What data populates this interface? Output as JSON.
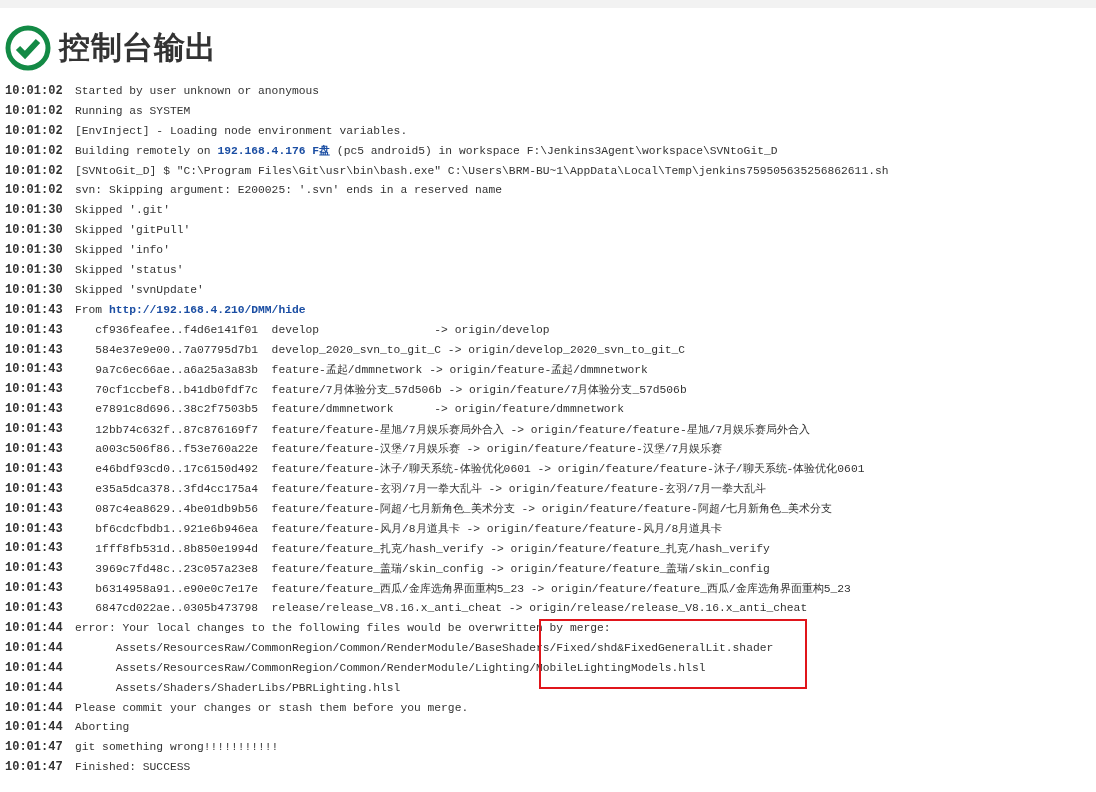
{
  "title": "控制台输出",
  "log": [
    {
      "time": "10:01:02",
      "segments": [
        {
          "kind": "plain",
          "text": "Started by user unknown or anonymous"
        }
      ]
    },
    {
      "time": "10:01:02",
      "segments": [
        {
          "kind": "plain",
          "text": "Running as SYSTEM"
        }
      ]
    },
    {
      "time": "10:01:02",
      "segments": [
        {
          "kind": "plain",
          "text": "[EnvInject] - Loading node environment variables."
        }
      ]
    },
    {
      "time": "10:01:02",
      "segments": [
        {
          "kind": "plain",
          "text": "Building remotely on "
        },
        {
          "kind": "link",
          "text": "192.168.4.176 F盘"
        },
        {
          "kind": "plain",
          "text": " (pc5 android5) in workspace F:\\Jenkins3Agent\\workspace\\SVNtoGit_D"
        }
      ]
    },
    {
      "time": "10:01:02",
      "segments": [
        {
          "kind": "plain",
          "text": "[SVNtoGit_D] $ \"C:\\Program Files\\Git\\usr\\bin\\bash.exe\" C:\\Users\\BRM-BU~1\\AppData\\Local\\Temp\\jenkins759505635256862611.sh"
        }
      ]
    },
    {
      "time": "10:01:02",
      "segments": [
        {
          "kind": "plain",
          "text": "svn: Skipping argument: E200025: '.svn' ends in a reserved name"
        }
      ]
    },
    {
      "time": "10:01:30",
      "segments": [
        {
          "kind": "plain",
          "text": "Skipped '.git'"
        }
      ]
    },
    {
      "time": "10:01:30",
      "segments": [
        {
          "kind": "plain",
          "text": "Skipped 'gitPull'"
        }
      ]
    },
    {
      "time": "10:01:30",
      "segments": [
        {
          "kind": "plain",
          "text": "Skipped 'info'"
        }
      ]
    },
    {
      "time": "10:01:30",
      "segments": [
        {
          "kind": "plain",
          "text": "Skipped 'status'"
        }
      ]
    },
    {
      "time": "10:01:30",
      "segments": [
        {
          "kind": "plain",
          "text": "Skipped 'svnUpdate'"
        }
      ]
    },
    {
      "time": "10:01:43",
      "segments": [
        {
          "kind": "plain",
          "text": "From "
        },
        {
          "kind": "link",
          "text": "http://192.168.4.210/DMM/hide"
        }
      ]
    },
    {
      "time": "10:01:43",
      "segments": [
        {
          "kind": "plain",
          "text": "   cf936feafee..f4d6e141f01  develop                 -> origin/develop"
        }
      ]
    },
    {
      "time": "10:01:43",
      "segments": [
        {
          "kind": "plain",
          "text": "   584e37e9e00..7a07795d7b1  develop_2020_svn_to_git_C -> origin/develop_2020_svn_to_git_C"
        }
      ]
    },
    {
      "time": "10:01:43",
      "segments": [
        {
          "kind": "plain",
          "text": "   9a7c6ec66ae..a6a25a3a83b  feature-孟起/dmmnetwork -> origin/feature-孟起/dmmnetwork"
        }
      ]
    },
    {
      "time": "10:01:43",
      "segments": [
        {
          "kind": "plain",
          "text": "   70cf1ccbef8..b41db0fdf7c  feature/7月体验分支_57d506b -> origin/feature/7月体验分支_57d506b"
        }
      ]
    },
    {
      "time": "10:01:43",
      "segments": [
        {
          "kind": "plain",
          "text": "   e7891c8d696..38c2f7503b5  feature/dmmnetwork      -> origin/feature/dmmnetwork"
        }
      ]
    },
    {
      "time": "10:01:43",
      "segments": [
        {
          "kind": "plain",
          "text": "   12bb74c632f..87c876169f7  feature/feature-星旭/7月娱乐赛局外合入 -> origin/feature/feature-星旭/7月娱乐赛局外合入"
        }
      ]
    },
    {
      "time": "10:01:43",
      "segments": [
        {
          "kind": "plain",
          "text": "   a003c506f86..f53e760a22e  feature/feature-汉堡/7月娱乐赛 -> origin/feature/feature-汉堡/7月娱乐赛"
        }
      ]
    },
    {
      "time": "10:01:43",
      "segments": [
        {
          "kind": "plain",
          "text": "   e46bdf93cd0..17c6150d492  feature/feature-沐子/聊天系统-体验优化0601 -> origin/feature/feature-沐子/聊天系统-体验优化0601"
        }
      ]
    },
    {
      "time": "10:01:43",
      "segments": [
        {
          "kind": "plain",
          "text": "   e35a5dca378..3fd4cc175a4  feature/feature-玄羽/7月一拳大乱斗 -> origin/feature/feature-玄羽/7月一拳大乱斗"
        }
      ]
    },
    {
      "time": "10:01:43",
      "segments": [
        {
          "kind": "plain",
          "text": "   087c4ea8629..4be01db9b56  feature/feature-阿超/七月新角色_美术分支 -> origin/feature/feature-阿超/七月新角色_美术分支"
        }
      ]
    },
    {
      "time": "10:01:43",
      "segments": [
        {
          "kind": "plain",
          "text": "   bf6cdcfbdb1..921e6b946ea  feature/feature-风月/8月道具卡 -> origin/feature/feature-风月/8月道具卡"
        }
      ]
    },
    {
      "time": "10:01:43",
      "segments": [
        {
          "kind": "plain",
          "text": "   1fff8fb531d..8b850e1994d  feature/feature_扎克/hash_verify -> origin/feature/feature_扎克/hash_verify"
        }
      ]
    },
    {
      "time": "10:01:43",
      "segments": [
        {
          "kind": "plain",
          "text": "   3969c7fd48c..23c057a23e8  feature/feature_盖瑞/skin_config -> origin/feature/feature_盖瑞/skin_config"
        }
      ]
    },
    {
      "time": "10:01:43",
      "segments": [
        {
          "kind": "plain",
          "text": "   b6314958a91..e90e0c7e17e  feature/feature_西瓜/金库选角界面重构5_23 -> origin/feature/feature_西瓜/金库选角界面重构5_23"
        }
      ]
    },
    {
      "time": "10:01:43",
      "segments": [
        {
          "kind": "plain",
          "text": "   6847cd022ae..0305b473798  release/release_V8.16.x_anti_cheat -> origin/release/release_V8.16.x_anti_cheat"
        }
      ]
    },
    {
      "time": "10:01:44",
      "segments": [
        {
          "kind": "plain",
          "text": "error: Your local changes to the following files would be overwritten by merge:"
        }
      ]
    },
    {
      "time": "10:01:44",
      "segments": [
        {
          "kind": "plain",
          "text": "      Assets/ResourcesRaw/CommonRegion/Common/RenderModule/BaseShaders/Fixed/shd&FixedGeneralLit.shader"
        }
      ]
    },
    {
      "time": "10:01:44",
      "segments": [
        {
          "kind": "plain",
          "text": "      Assets/ResourcesRaw/CommonRegion/Common/RenderModule/Lighting/MobileLightingModels.hlsl"
        }
      ]
    },
    {
      "time": "10:01:44",
      "segments": [
        {
          "kind": "plain",
          "text": "      Assets/Shaders/ShaderLibs/PBRLighting.hlsl"
        }
      ]
    },
    {
      "time": "10:01:44",
      "segments": [
        {
          "kind": "plain",
          "text": "Please commit your changes or stash them before you merge."
        }
      ]
    },
    {
      "time": "10:01:44",
      "segments": [
        {
          "kind": "plain",
          "text": "Aborting"
        }
      ]
    },
    {
      "time": "10:01:47",
      "segments": [
        {
          "kind": "plain",
          "text": "git something wrong!!!!!!!!!!!"
        }
      ]
    },
    {
      "time": "10:01:47",
      "segments": [
        {
          "kind": "plain",
          "text": "Finished: SUCCESS"
        }
      ]
    }
  ]
}
